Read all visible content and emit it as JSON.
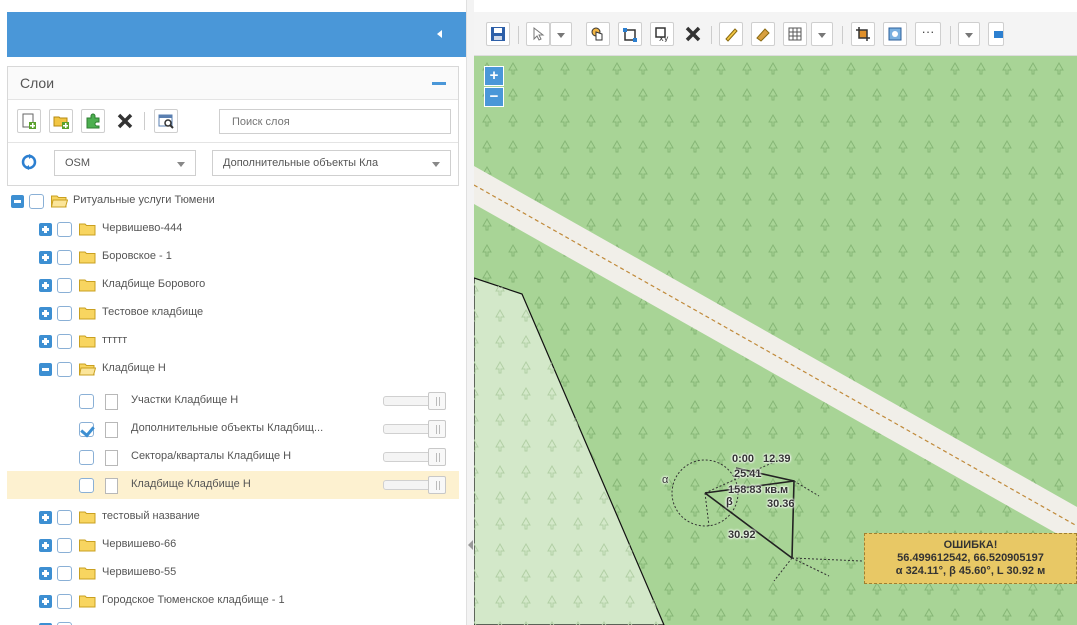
{
  "layers_panel": {
    "title": "Слои",
    "search_placeholder": "Поиск слоя",
    "basemap_select": "OSM",
    "group_select": "Дополнительные объекты Кла"
  },
  "tree": {
    "root": {
      "label": "Ритуальные услуги Тюмени",
      "expanded": true,
      "checked": false
    },
    "groups": [
      {
        "label": "Червишево-444",
        "expanded": false
      },
      {
        "label": "Боровское - 1",
        "expanded": false
      },
      {
        "label": "Кладбище Борового",
        "expanded": false
      },
      {
        "label": "Тестовое кладбище",
        "expanded": false
      },
      {
        "label": "ттттт",
        "expanded": false
      },
      {
        "label": "Кладбище Н",
        "expanded": true
      }
    ],
    "layers": [
      {
        "label": "Участки Кладбище Н",
        "checked": false,
        "opacity": 1.0
      },
      {
        "label": "Дополнительные объекты Кладбищ...",
        "checked": true,
        "opacity": 1.0
      },
      {
        "label": "Сектора/кварталы Кладбище Н",
        "checked": false,
        "opacity": 1.0
      },
      {
        "label": "Кладбище Кладбище Н",
        "checked": false,
        "opacity": 1.0,
        "selected": true
      }
    ],
    "groups_after": [
      {
        "label": "тестовый название",
        "expanded": false
      },
      {
        "label": "Червишево-66",
        "expanded": false
      },
      {
        "label": "Червишево-55",
        "expanded": false
      },
      {
        "label": "Городское Тюменское кладбище - 1",
        "expanded": false
      }
    ]
  },
  "map": {
    "zoom_in_label": "+",
    "zoom_out_label": "−",
    "toolbar_more_label": "···",
    "measure": {
      "time": "0:00",
      "length_top": "12.39",
      "angle_value": "25.41",
      "area": "158.83 кв.м",
      "beta_label": "β",
      "alpha_label": "α",
      "side_right": "30.36",
      "side_bottom": "30.92"
    },
    "error": {
      "title": "ОШИБКА!",
      "coords": "56.499612542, 66.520905197",
      "params": "α 324.11°, β 45.60°, L 30.92 м"
    }
  },
  "colors": {
    "accent": "#4a97d8",
    "map_green": "#a8d496",
    "map_light": "#d3e8c9",
    "road": "#f1efe9",
    "error_bg": "#e8c865",
    "selected_row": "#fdf1d0"
  }
}
